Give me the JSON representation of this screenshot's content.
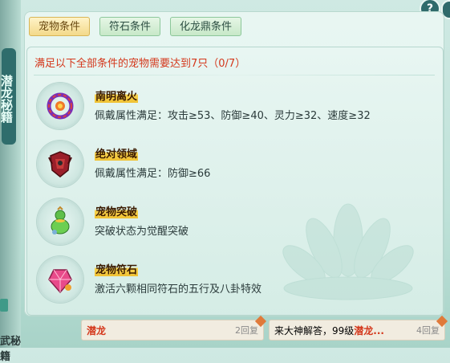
{
  "help": {
    "label": "?"
  },
  "background": {
    "side_title": "潜龙秘籍",
    "bottom_left_text": "武秘籍"
  },
  "tabs": [
    {
      "label": "宠物条件",
      "active": true
    },
    {
      "label": "符石条件",
      "active": false
    },
    {
      "label": "化龙鼎条件",
      "active": false
    }
  ],
  "condition_header": "满足以下全部条件的宠物需要达到7只（0/7）",
  "conditions": [
    {
      "icon": "ring-icon",
      "title": "南明离火",
      "desc": "佩戴属性满足：攻击≥53、防御≥40、灵力≥32、速度≥32"
    },
    {
      "icon": "armor-icon",
      "title": "绝对领域",
      "desc": "佩戴属性满足：防御≥66"
    },
    {
      "icon": "gourd-icon",
      "title": "宠物突破",
      "desc": "突破状态为觉醒突破"
    },
    {
      "icon": "gem-icon",
      "title": "宠物符石",
      "desc": "激活六颗相同符石的五行及八卦特效"
    }
  ],
  "chat": [
    {
      "name": "潜龙",
      "reply": "2回复"
    },
    {
      "text": "来大神解答，99级",
      "name": "潜龙...",
      "reply": "4回复"
    }
  ],
  "colors": {
    "accent_red": "#d4381c",
    "title_highlight": "#f0c132",
    "panel_bg": "#e4f4ef"
  }
}
